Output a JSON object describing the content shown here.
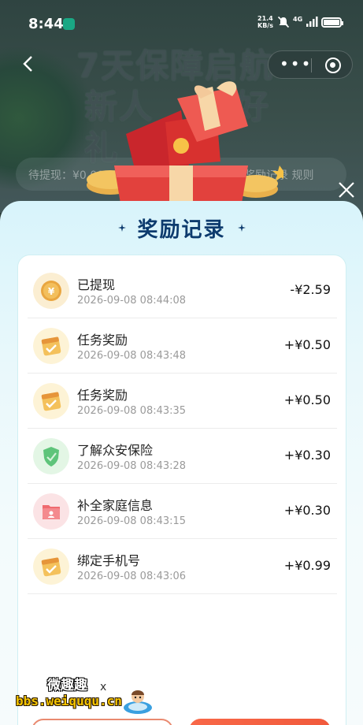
{
  "status_bar": {
    "time": "8:44",
    "net_speed": "21.4",
    "net_unit": "KB/s",
    "signal_label": "4G"
  },
  "background": {
    "title_line1": "7天保障启航",
    "title_line2": "新人",
    "title_line2_end": "好礼",
    "pending_label": "待提现：¥0.00",
    "links_label": "奖励记录  规则"
  },
  "sheet": {
    "title": "奖励记录"
  },
  "records": [
    {
      "name": "已提现",
      "time": "2026-09-08 08:44:08",
      "amount": "-¥2.59",
      "icon": "coin-icon"
    },
    {
      "name": "任务奖励",
      "time": "2026-09-08 08:43:48",
      "amount": "+¥0.50",
      "icon": "calendar-check-icon"
    },
    {
      "name": "任务奖励",
      "time": "2026-09-08 08:43:35",
      "amount": "+¥0.50",
      "icon": "calendar-check-icon"
    },
    {
      "name": "了解众安保险",
      "time": "2026-09-08 08:43:28",
      "amount": "+¥0.30",
      "icon": "shield-icon"
    },
    {
      "name": "补全家庭信息",
      "time": "2026-09-08 08:43:15",
      "amount": "+¥0.30",
      "icon": "folder-family-icon"
    },
    {
      "name": "绑定手机号",
      "time": "2026-09-08 08:43:06",
      "amount": "+¥0.99",
      "icon": "calendar-check-icon"
    }
  ],
  "watermark": {
    "line1": "微趣趣",
    "line2": "bbs.weiququ.cn",
    "mark": "x"
  },
  "colors": {
    "title": "#0d3b6e",
    "sheet_top": "#d8f4fb",
    "button_primary": "#f15a3c",
    "button_outline": "#e98a70"
  }
}
